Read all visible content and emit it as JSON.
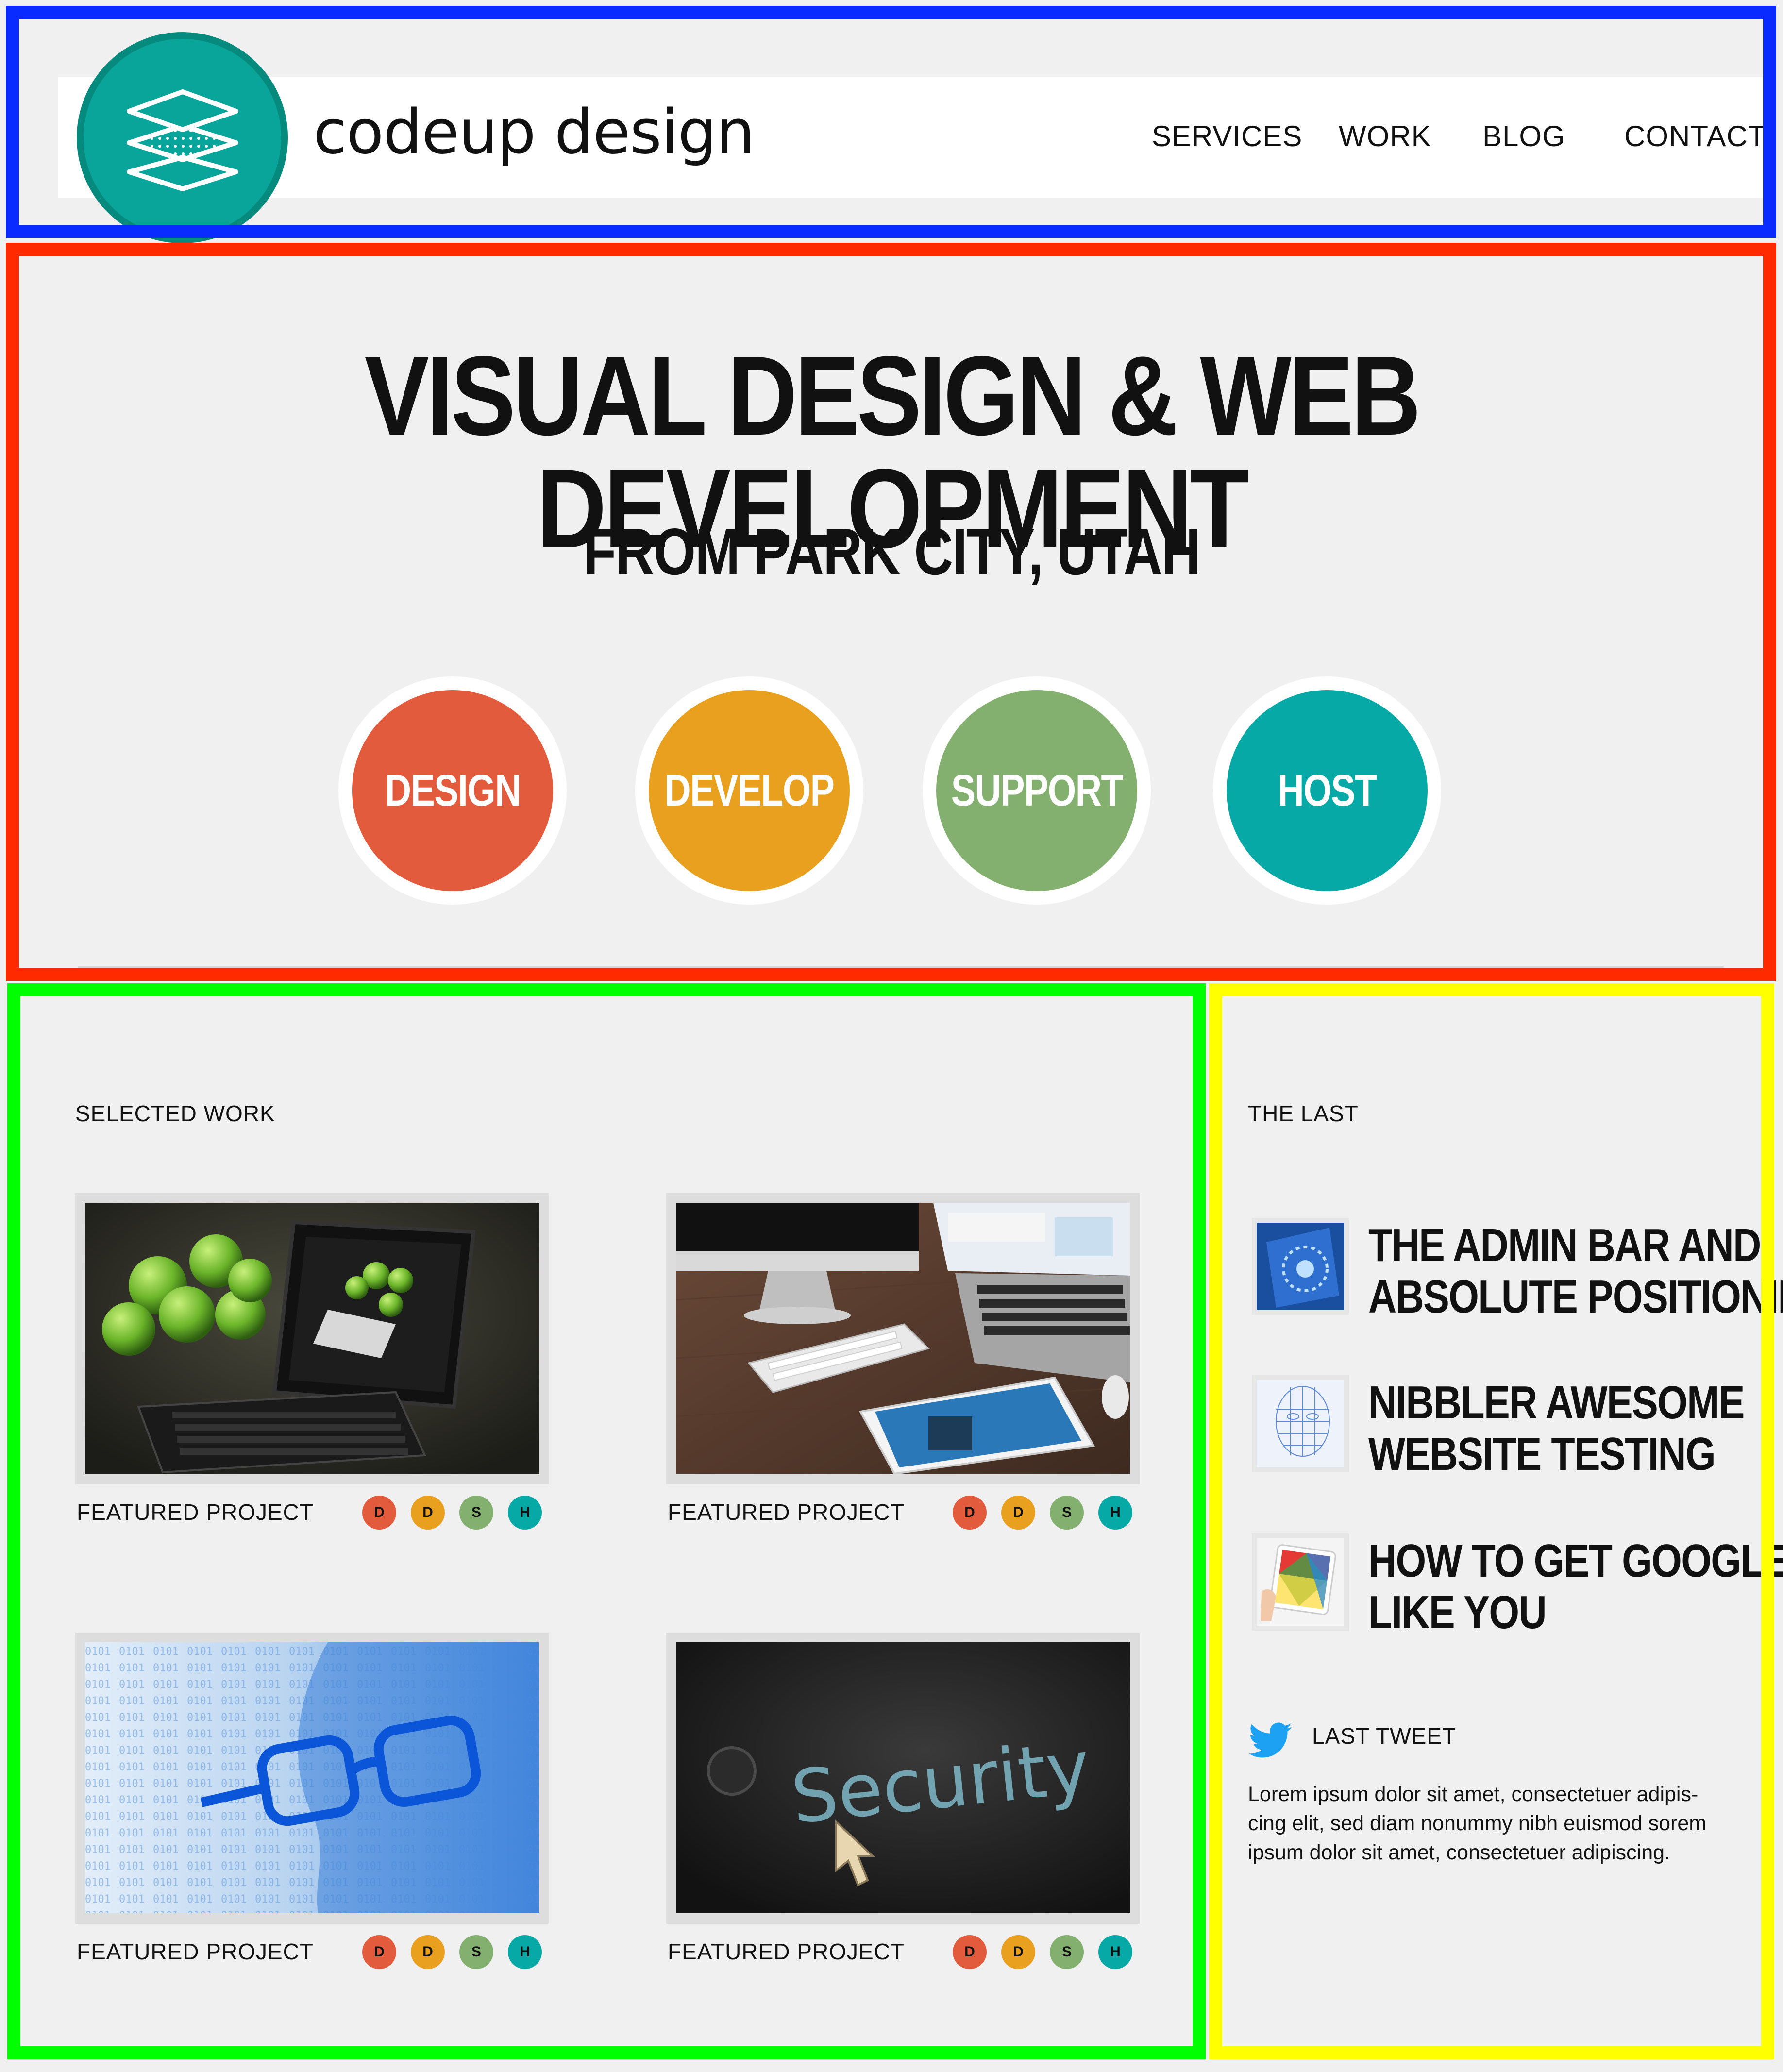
{
  "colors": {
    "teal": "#0aa59a",
    "design": "#e35b3d",
    "develop": "#e8a01e",
    "support": "#83b06f",
    "host": "#07a9a6",
    "twitter": "#1da1f2"
  },
  "header": {
    "brand": "codeup design",
    "logo_icon": "layers-icon",
    "nav": [
      "SERVICES",
      "WORK",
      "BLOG",
      "CONTACT"
    ]
  },
  "hero": {
    "title": "VISUAL DESIGN & WEB DEVELOPMENT",
    "subtitle": "FROM PARK CITY, UTAH",
    "services": [
      "DESIGN",
      "DEVELOP",
      "SUPPORT",
      "HOST"
    ]
  },
  "work": {
    "label": "SELECTED WORK",
    "projects": [
      {
        "caption": "FEATURED PROJECT",
        "image": "apples-tablet-keyboard-photo",
        "badges": [
          "D",
          "D",
          "S",
          "H"
        ]
      },
      {
        "caption": "FEATURED PROJECT",
        "image": "desk-imac-laptop-tablet-photo",
        "badges": [
          "D",
          "D",
          "S",
          "H"
        ]
      },
      {
        "caption": "FEATURED PROJECT",
        "image": "binary-face-glasses-photo",
        "badges": [
          "D",
          "D",
          "S",
          "H"
        ]
      },
      {
        "caption": "FEATURED PROJECT",
        "image": "security-screen-cursor-photo",
        "badges": [
          "D",
          "D",
          "S",
          "H"
        ]
      }
    ]
  },
  "sidebar": {
    "label": "THE LAST",
    "posts": [
      {
        "title_line1": "THE ADMIN BAR AND",
        "title_line2": "ABSOLUTE POSITIONING",
        "thumb": "social-phone-thumb"
      },
      {
        "title_line1": "NIBBLER AWESOME",
        "title_line2": "WEBSITE TESTING",
        "thumb": "wireframe-face-thumb"
      },
      {
        "title_line1": "HOW TO GET GOOGLE TO",
        "title_line2": "LIKE YOU",
        "thumb": "colorful-tablet-thumb"
      }
    ],
    "tweet_label": "LAST TWEET",
    "tweet_icon": "twitter-bird-icon",
    "tweet_lines": [
      "Lorem ipsum dolor sit amet, consectetuer adipis-",
      "cing elit, sed diam nonummy nibh euismod sorem",
      "ipsum dolor sit amet, consectetuer adipiscing."
    ]
  }
}
